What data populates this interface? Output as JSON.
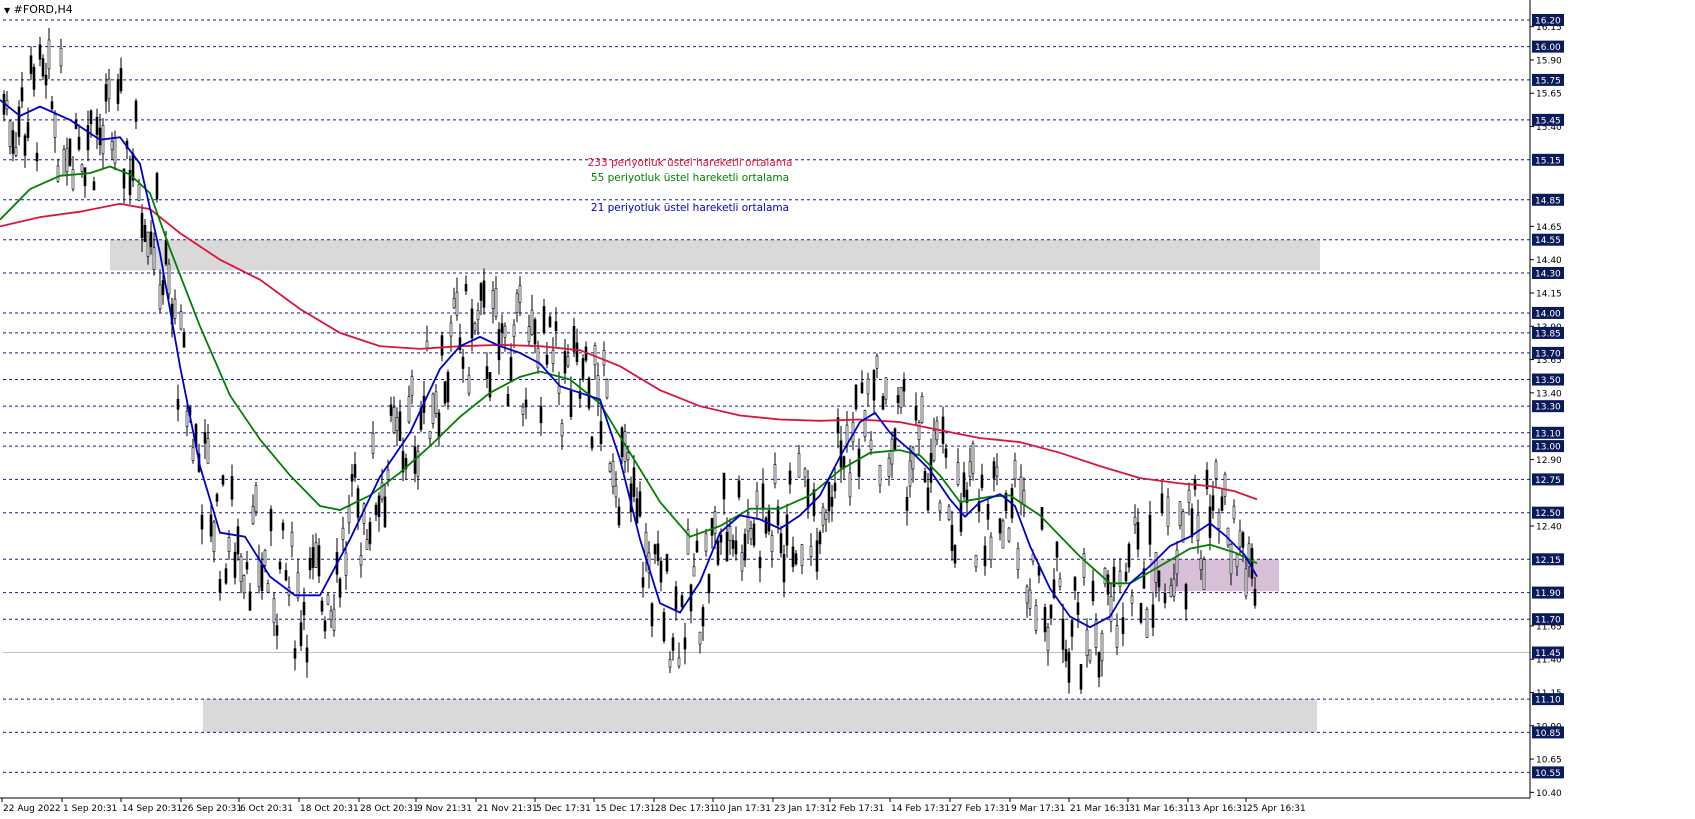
{
  "window": {
    "title": "#FORD,H4",
    "menu_icon": "triangle-down-icon"
  },
  "chart_data": {
    "type": "candlestick",
    "symbol": "#FORD",
    "timeframe": "H4",
    "ylim": [
      10.35,
      16.25
    ],
    "y_ticks": [
      16.15,
      15.9,
      15.65,
      15.4,
      14.65,
      14.4,
      14.15,
      13.9,
      13.65,
      13.4,
      12.9,
      12.4,
      11.65,
      11.4,
      11.15,
      10.9,
      10.65,
      10.4
    ],
    "highlighted_levels": [
      16.2,
      16.0,
      15.75,
      15.45,
      15.15,
      14.85,
      14.55,
      14.3,
      14.0,
      13.85,
      13.7,
      13.5,
      13.3,
      13.1,
      13.0,
      12.75,
      12.5,
      12.15,
      11.9,
      11.7,
      11.45,
      11.1,
      10.85,
      10.55
    ],
    "current_price": 11.45,
    "x_ticks": [
      "22 Aug 2022",
      "1 Sep 20:31",
      "14 Sep 20:31",
      "26 Sep 20:31",
      "6 Oct 20:31",
      "18 Oct 20:31",
      "28 Oct 20:31",
      "9 Nov 21:31",
      "21 Nov 21:31",
      "5 Dec 17:31",
      "15 Dec 17:31",
      "28 Dec 17:31",
      "10 Jan 17:31",
      "23 Jan 17:31",
      "2 Feb 17:31",
      "14 Feb 17:31",
      "27 Feb 17:31",
      "9 Mar 17:31",
      "21 Mar 16:31",
      "31 Mar 16:31",
      "13 Apr 16:31",
      "25 Apr 16:31"
    ],
    "annotations": [
      {
        "text": "233 periyotluk üstel hareketli ortalama",
        "color": "#dc143c"
      },
      {
        "text": "55 periyotluk üstel hareketli ortalama",
        "color": "#008000"
      },
      {
        "text": "21 periyotluk üstel hareketli ortalama",
        "color": "#0000cd"
      }
    ],
    "zones": [
      {
        "name": "resistance-zone",
        "y_range": [
          14.32,
          14.55
        ],
        "color": "#d9d9d9"
      },
      {
        "name": "support-zone",
        "y_range": [
          10.85,
          11.1
        ],
        "color": "#d9d9d9"
      },
      {
        "name": "recent-resistance-zone",
        "y_range": [
          11.91,
          12.15
        ],
        "color": "#d8bfd8"
      }
    ],
    "series": [
      {
        "name": "233 EMA",
        "color": "#dc143c",
        "points": [
          [
            0,
            14.65
          ],
          [
            40,
            14.72
          ],
          [
            80,
            14.76
          ],
          [
            120,
            14.82
          ],
          [
            150,
            14.78
          ],
          [
            180,
            14.6
          ],
          [
            220,
            14.4
          ],
          [
            260,
            14.25
          ],
          [
            300,
            14.03
          ],
          [
            340,
            13.85
          ],
          [
            380,
            13.75
          ],
          [
            420,
            13.73
          ],
          [
            460,
            13.75
          ],
          [
            500,
            13.76
          ],
          [
            540,
            13.75
          ],
          [
            580,
            13.72
          ],
          [
            620,
            13.6
          ],
          [
            660,
            13.42
          ],
          [
            700,
            13.3
          ],
          [
            740,
            13.23
          ],
          [
            780,
            13.2
          ],
          [
            820,
            13.19
          ],
          [
            860,
            13.2
          ],
          [
            900,
            13.18
          ],
          [
            940,
            13.12
          ],
          [
            980,
            13.06
          ],
          [
            1020,
            13.03
          ],
          [
            1060,
            12.95
          ],
          [
            1100,
            12.85
          ],
          [
            1140,
            12.76
          ],
          [
            1180,
            12.72
          ],
          [
            1210,
            12.7
          ],
          [
            1235,
            12.66
          ],
          [
            1257,
            12.6
          ]
        ]
      },
      {
        "name": "55 EMA",
        "color": "#008000",
        "points": [
          [
            0,
            14.7
          ],
          [
            30,
            14.93
          ],
          [
            60,
            15.03
          ],
          [
            90,
            15.05
          ],
          [
            110,
            15.1
          ],
          [
            130,
            15.04
          ],
          [
            150,
            14.9
          ],
          [
            170,
            14.48
          ],
          [
            200,
            13.9
          ],
          [
            230,
            13.38
          ],
          [
            260,
            13.05
          ],
          [
            290,
            12.78
          ],
          [
            320,
            12.55
          ],
          [
            340,
            12.52
          ],
          [
            370,
            12.63
          ],
          [
            400,
            12.8
          ],
          [
            430,
            13.0
          ],
          [
            460,
            13.22
          ],
          [
            490,
            13.4
          ],
          [
            520,
            13.52
          ],
          [
            540,
            13.56
          ],
          [
            570,
            13.5
          ],
          [
            600,
            13.32
          ],
          [
            630,
            12.95
          ],
          [
            660,
            12.58
          ],
          [
            690,
            12.32
          ],
          [
            720,
            12.4
          ],
          [
            750,
            12.53
          ],
          [
            780,
            12.53
          ],
          [
            810,
            12.63
          ],
          [
            840,
            12.82
          ],
          [
            870,
            12.95
          ],
          [
            900,
            12.97
          ],
          [
            920,
            12.93
          ],
          [
            940,
            12.78
          ],
          [
            960,
            12.58
          ],
          [
            990,
            12.62
          ],
          [
            1010,
            12.63
          ],
          [
            1040,
            12.48
          ],
          [
            1080,
            12.17
          ],
          [
            1110,
            11.97
          ],
          [
            1130,
            11.97
          ],
          [
            1160,
            12.1
          ],
          [
            1190,
            12.23
          ],
          [
            1210,
            12.26
          ],
          [
            1235,
            12.2
          ],
          [
            1257,
            12.12
          ]
        ]
      },
      {
        "name": "21 EMA",
        "color": "#0000cd",
        "points": [
          [
            0,
            15.6
          ],
          [
            20,
            15.48
          ],
          [
            40,
            15.55
          ],
          [
            70,
            15.45
          ],
          [
            100,
            15.3
          ],
          [
            120,
            15.32
          ],
          [
            140,
            15.12
          ],
          [
            160,
            14.45
          ],
          [
            180,
            13.6
          ],
          [
            200,
            12.85
          ],
          [
            220,
            12.35
          ],
          [
            245,
            12.32
          ],
          [
            270,
            12.02
          ],
          [
            295,
            11.88
          ],
          [
            320,
            11.88
          ],
          [
            350,
            12.3
          ],
          [
            380,
            12.77
          ],
          [
            410,
            13.1
          ],
          [
            440,
            13.58
          ],
          [
            460,
            13.75
          ],
          [
            480,
            13.82
          ],
          [
            500,
            13.75
          ],
          [
            520,
            13.7
          ],
          [
            540,
            13.62
          ],
          [
            560,
            13.45
          ],
          [
            580,
            13.4
          ],
          [
            600,
            13.35
          ],
          [
            620,
            12.9
          ],
          [
            640,
            12.3
          ],
          [
            660,
            11.82
          ],
          [
            680,
            11.75
          ],
          [
            700,
            11.98
          ],
          [
            720,
            12.35
          ],
          [
            740,
            12.48
          ],
          [
            760,
            12.45
          ],
          [
            780,
            12.38
          ],
          [
            800,
            12.48
          ],
          [
            820,
            12.63
          ],
          [
            840,
            12.92
          ],
          [
            860,
            13.18
          ],
          [
            875,
            13.25
          ],
          [
            890,
            13.1
          ],
          [
            910,
            12.97
          ],
          [
            930,
            12.82
          ],
          [
            950,
            12.6
          ],
          [
            965,
            12.47
          ],
          [
            980,
            12.58
          ],
          [
            1000,
            12.64
          ],
          [
            1015,
            12.55
          ],
          [
            1030,
            12.25
          ],
          [
            1050,
            11.93
          ],
          [
            1070,
            11.72
          ],
          [
            1090,
            11.64
          ],
          [
            1110,
            11.72
          ],
          [
            1130,
            11.97
          ],
          [
            1150,
            12.1
          ],
          [
            1170,
            12.25
          ],
          [
            1190,
            12.32
          ],
          [
            1210,
            12.42
          ],
          [
            1225,
            12.33
          ],
          [
            1245,
            12.18
          ],
          [
            1257,
            12.02
          ]
        ]
      }
    ]
  }
}
